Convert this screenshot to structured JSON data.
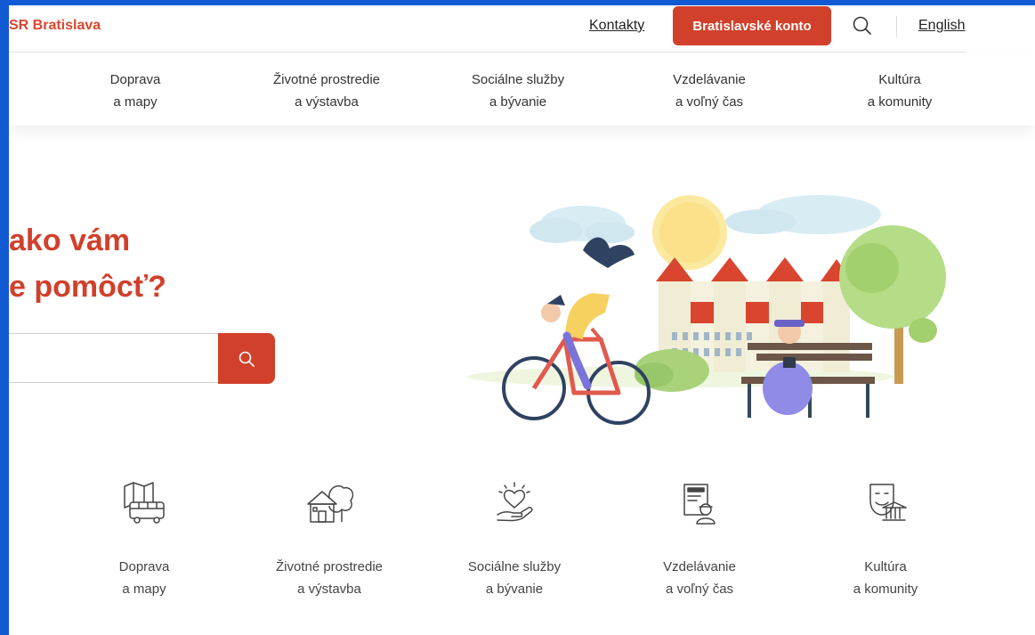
{
  "header": {
    "brand": "SR Bratislava",
    "contacts": "Kontakty",
    "account_button": "Bratislavské konto",
    "search_icon": "search-icon",
    "language": "English"
  },
  "nav": {
    "items": [
      {
        "line1": "Doprava",
        "line2": "a mapy"
      },
      {
        "line1": "Životné prostredie",
        "line2": "a výstavba"
      },
      {
        "line1": "Sociálne služby",
        "line2": "a bývanie"
      },
      {
        "line1": "Vzdelávanie",
        "line2": "a voľný čas"
      },
      {
        "line1": "Kultúra",
        "line2": "a komunity"
      }
    ]
  },
  "hero": {
    "headline_line1": "ako vám",
    "headline_line2": "e pomôcť?",
    "search_placeholder": "",
    "search_button_icon": "search-icon"
  },
  "tiles": [
    {
      "icon": "transport-map-icon",
      "line1": "Doprava",
      "line2": "a mapy"
    },
    {
      "icon": "house-tree-icon",
      "line1": "Životné prostredie",
      "line2": "a výstavba"
    },
    {
      "icon": "heart-hand-icon",
      "line1": "Sociálne služby",
      "line2": "a bývanie"
    },
    {
      "icon": "document-person-icon",
      "line1": "Vzdelávanie",
      "line2": "a voľný čas"
    },
    {
      "icon": "theatre-mask-icon",
      "line1": "Kultúra",
      "line2": "a komunity"
    }
  ],
  "colors": {
    "accent": "#d1402b",
    "frame": "#1259d4"
  }
}
